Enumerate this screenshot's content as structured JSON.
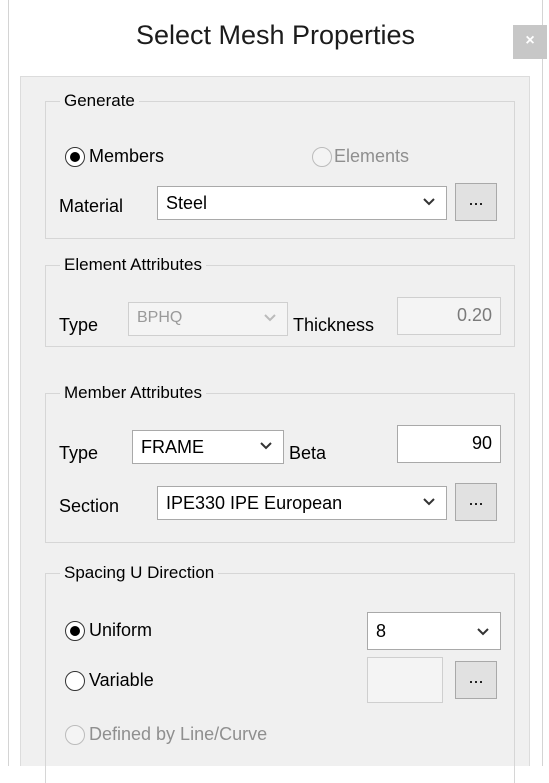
{
  "dialog": {
    "title": "Select Mesh Properties",
    "close_label": "×"
  },
  "generate": {
    "legend": "Generate",
    "members_label": "Members",
    "elements_label": "Elements",
    "selected": "Members",
    "material_label": "Material",
    "material_value": "Steel",
    "material_browse_label": "..."
  },
  "element_attributes": {
    "legend": "Element Attributes",
    "type_label": "Type",
    "type_value": "BPHQ",
    "thickness_label": "Thickness",
    "thickness_value": "0.20"
  },
  "member_attributes": {
    "legend": "Member Attributes",
    "type_label": "Type",
    "type_value": "FRAME",
    "beta_label": "Beta",
    "beta_value": "90",
    "section_label": "Section",
    "section_value": "IPE330 IPE European",
    "section_browse_label": "..."
  },
  "spacing_u": {
    "legend": "Spacing U Direction",
    "uniform_label": "Uniform",
    "uniform_value": "8",
    "variable_label": "Variable",
    "variable_value": "",
    "variable_browse_label": "...",
    "defined_by_curve_label": "Defined by Line/Curve",
    "selected": "Uniform"
  }
}
